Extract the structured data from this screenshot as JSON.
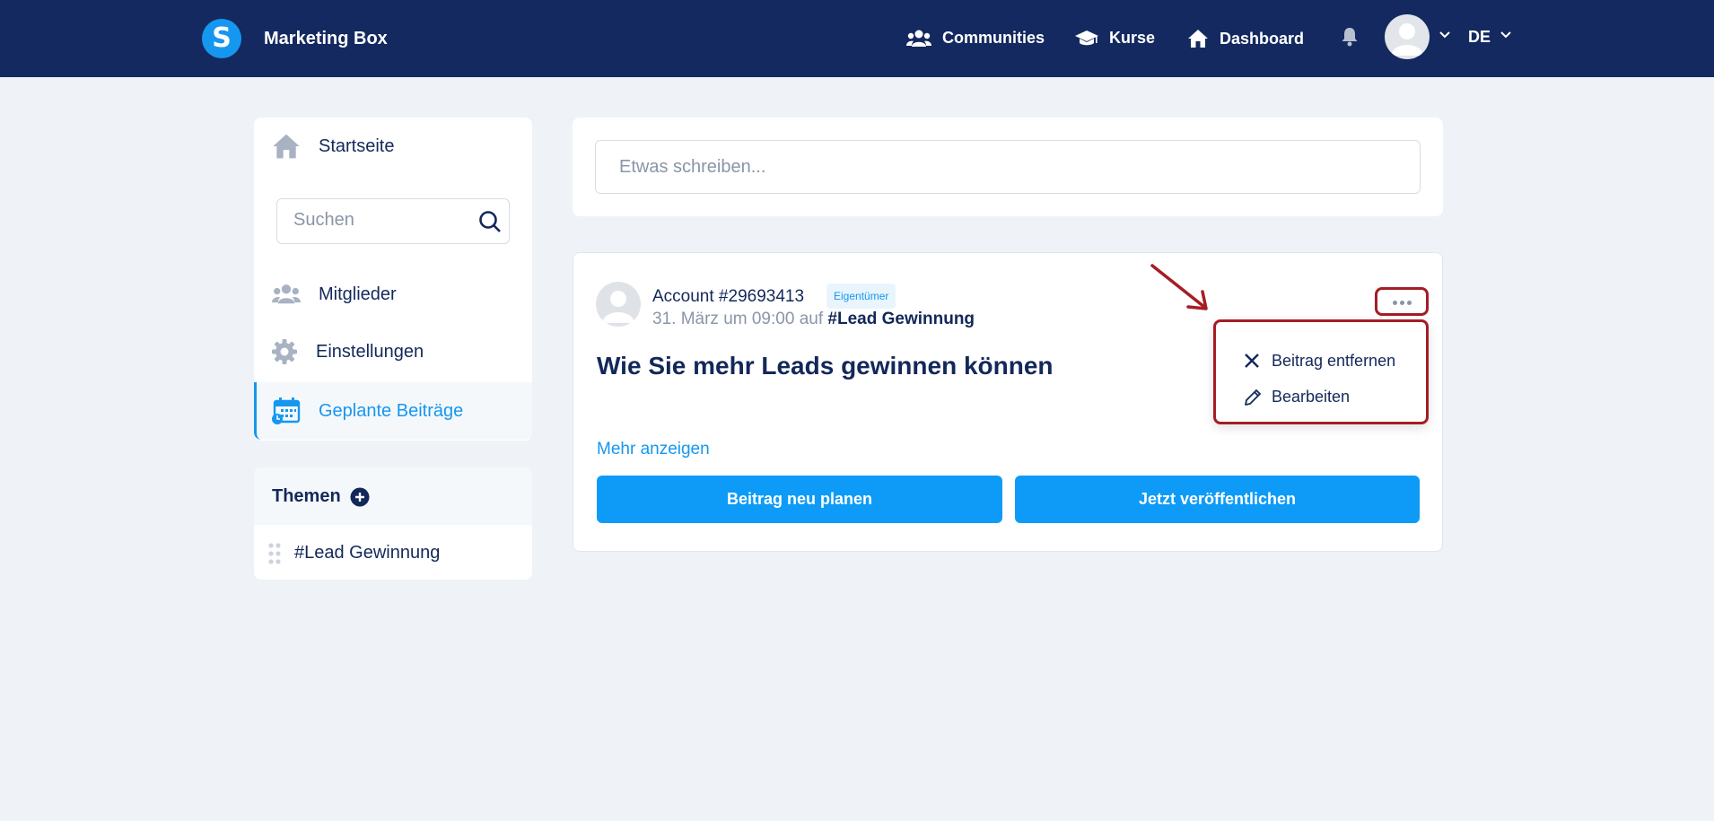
{
  "navbar": {
    "logo_letter": "S",
    "brand": "Marketing Box",
    "links": [
      {
        "label": "Communities",
        "icon": "users-icon"
      },
      {
        "label": "Kurse",
        "icon": "graduation-cap-icon"
      },
      {
        "label": "Dashboard",
        "icon": "home-icon"
      }
    ],
    "language": "DE"
  },
  "sidebar": {
    "home_label": "Startseite",
    "search_placeholder": "Suchen",
    "items": [
      {
        "label": "Mitglieder",
        "icon": "members-icon"
      },
      {
        "label": "Einstellungen",
        "icon": "gear-icon"
      },
      {
        "label": "Geplante Beiträge",
        "icon": "calendar-icon",
        "active": true
      }
    ],
    "topics_title": "Themen",
    "topics": [
      "#Lead Gewinnung"
    ]
  },
  "composer": {
    "placeholder": "Etwas schreiben..."
  },
  "post": {
    "author": "Account #29693413",
    "badge": "Eigentümer",
    "date": "31. März um 09:00",
    "on_word": "auf",
    "topic": "#Lead Gewinnung",
    "title": "Wie Sie mehr Leads gewinnen können",
    "more_link": "Mehr anzeigen",
    "reschedule_button": "Beitrag neu planen",
    "publish_button": "Jetzt veröffentlichen"
  },
  "post_menu": {
    "remove_label": "Beitrag entfernen",
    "edit_label": "Bearbeiten"
  },
  "colors": {
    "navbar": "#13295f",
    "accent": "#1597f0",
    "highlight": "#a51d24"
  }
}
